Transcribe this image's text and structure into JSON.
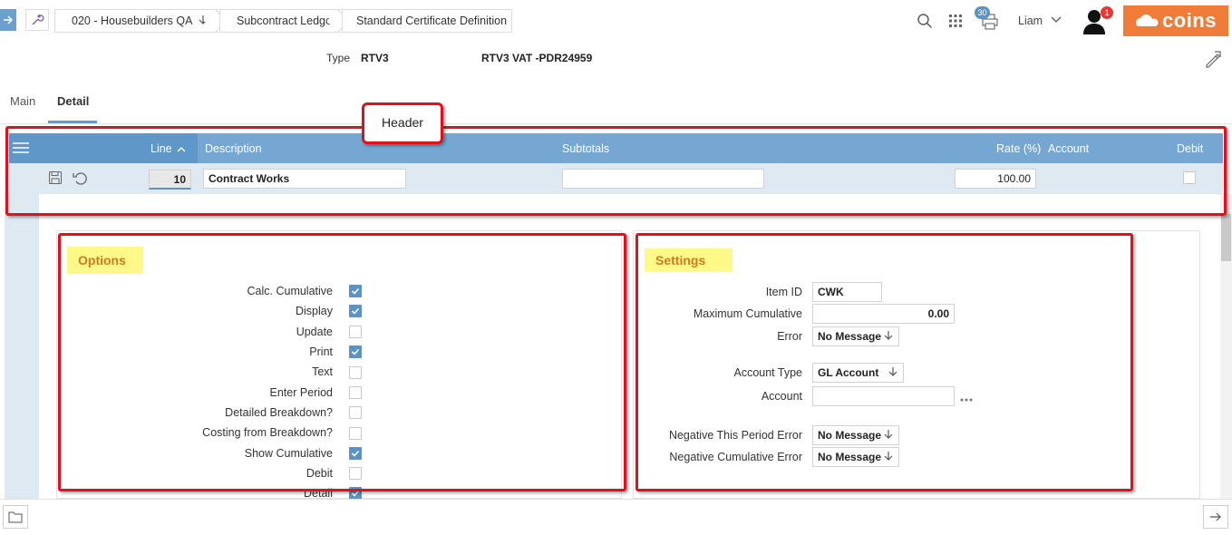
{
  "breadcrumbs": [
    {
      "label": "020 - Housebuilders QA",
      "has_dropdown": true
    },
    {
      "label": "Subcontract Ledger"
    },
    {
      "label": "Standard Certificate Definition"
    }
  ],
  "topbar": {
    "print_badge": "30",
    "user_name": "Liam",
    "notification_count": "1",
    "logo_text": "coins"
  },
  "record": {
    "type_label": "Type",
    "type_value": "RTV3",
    "description": "RTV3 VAT -PDR24959"
  },
  "tabs": [
    {
      "label": "Main",
      "active": false
    },
    {
      "label": "Detail",
      "active": true
    }
  ],
  "annotation": {
    "header_callout": "Header"
  },
  "grid": {
    "columns": [
      "Line",
      "Description",
      "Subtotals",
      "Rate (%)",
      "Account",
      "Debit"
    ],
    "row": {
      "line": "10",
      "description": "Contract Works",
      "subtotals": "",
      "rate": "100.00",
      "account": "",
      "debit": false
    }
  },
  "options": {
    "title": "Options",
    "items": [
      {
        "label": "Calc. Cumulative",
        "checked": true
      },
      {
        "label": "Display",
        "checked": true
      },
      {
        "label": "Update",
        "checked": false
      },
      {
        "label": "Print",
        "checked": true
      },
      {
        "label": "Text",
        "checked": false
      },
      {
        "label": "Enter Period",
        "checked": false
      },
      {
        "label": "Detailed Breakdown?",
        "checked": false
      },
      {
        "label": "Costing from Breakdown?",
        "checked": false
      },
      {
        "label": "Show Cumulative",
        "checked": true
      },
      {
        "label": "Debit",
        "checked": false
      },
      {
        "label": "Detail",
        "checked": true
      }
    ]
  },
  "settings": {
    "title": "Settings",
    "item_id_label": "Item ID",
    "item_id": "CWK",
    "max_cumulative_label": "Maximum Cumulative",
    "max_cumulative": "0.00",
    "error_label": "Error",
    "error": "No Message",
    "account_type_label": "Account Type",
    "account_type": "GL Account",
    "account_label": "Account",
    "account": "",
    "neg_period_label": "Negative This Period Error",
    "neg_period": "No Message",
    "neg_cumulative_label": "Negative Cumulative Error",
    "neg_cumulative": "No Message"
  },
  "colors": {
    "accent": "#5c9ed3",
    "grid_header": "#75a7d2",
    "annotation_red": "#e2101c",
    "section_highlight": "#fff98a",
    "logo": "#f07c3a"
  }
}
